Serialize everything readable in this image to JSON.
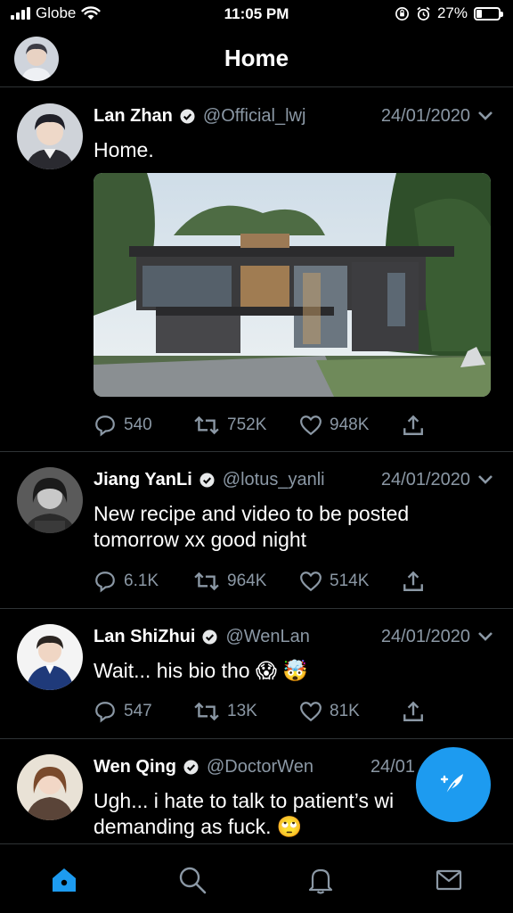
{
  "status_bar": {
    "carrier": "Globe",
    "time": "11:05 PM",
    "battery": "27%",
    "battery_level": 0.27
  },
  "header": {
    "title": "Home"
  },
  "tweets": [
    {
      "name": "Lan Zhan",
      "handle": "@Official_lwj",
      "date": "24/01/2020",
      "text": "Home.",
      "replies": "540",
      "retweets": "752K",
      "likes": "948K"
    },
    {
      "name": "Jiang YanLi",
      "handle": "@lotus_yanli",
      "date": "24/01/2020",
      "text": "New recipe and video to be posted tomorrow xx good night",
      "replies": "6.1K",
      "retweets": "964K",
      "likes": "514K"
    },
    {
      "name": "Lan ShiZhui",
      "handle": "@WenLan",
      "date": "24/01/2020",
      "text": "Wait... his bio tho 😱 🤯",
      "replies": "547",
      "retweets": "13K",
      "likes": "81K"
    },
    {
      "name": "Wen Qing",
      "handle": "@DoctorWen",
      "date": "24/01",
      "text": "Ugh... i hate to talk to patient’s wi",
      "text_line2": "demanding as fuck. 🙄"
    }
  ],
  "colors": {
    "accent": "#1d9bf0",
    "muted": "#8b98a5",
    "divider": "#2f3336",
    "background": "#000000"
  },
  "icons": {
    "nav": [
      "home-icon",
      "search-icon",
      "notifications-bell-icon",
      "messages-envelope-icon"
    ],
    "fab": "compose-quill-icon"
  }
}
